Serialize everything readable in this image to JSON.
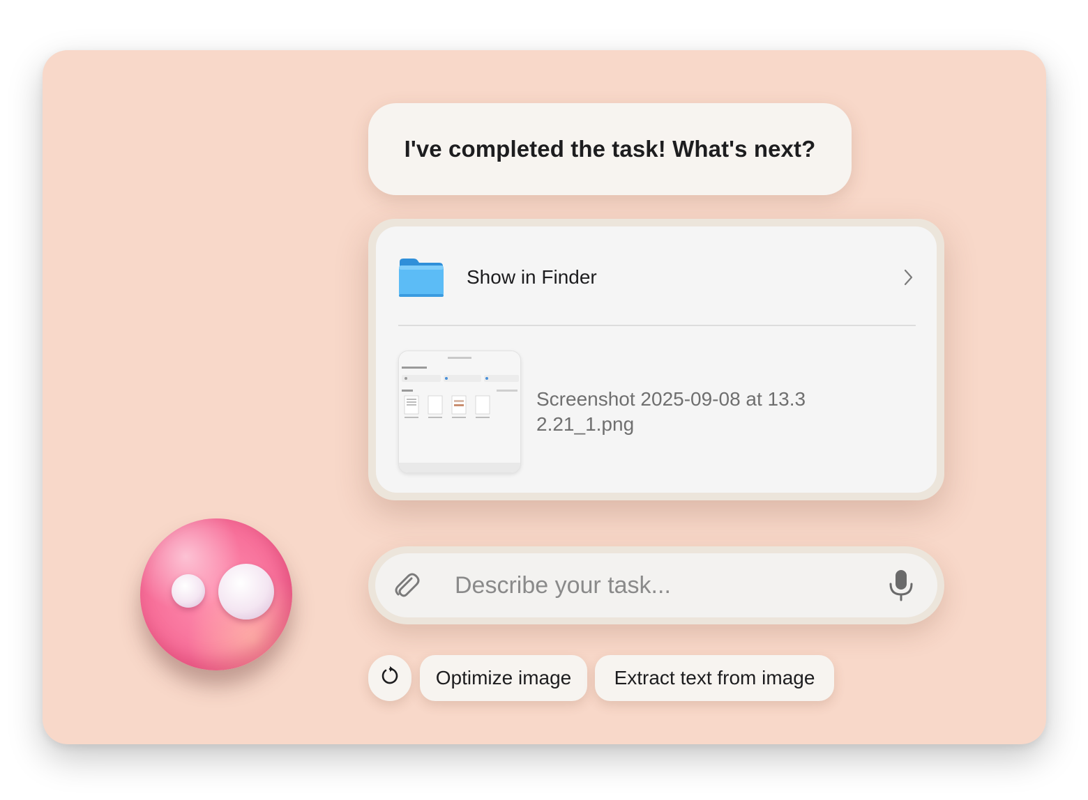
{
  "assistant": {
    "message": "I've completed the task! What's next?"
  },
  "result_card": {
    "show_in_finder_label": "Show in Finder",
    "file_name": "Screenshot 2025-09-08 at 13.32.21_1.png"
  },
  "composer": {
    "placeholder": "Describe your task...",
    "value": ""
  },
  "suggestions": {
    "refresh_icon": "refresh-icon",
    "items": [
      {
        "label": "Optimize image"
      },
      {
        "label": "Extract text from image"
      }
    ]
  },
  "colors": {
    "window_bg": "#f8d8c9",
    "card_bg": "#f5f5f5",
    "folder_blue": "#5cbcf6",
    "mascot_pink": "#f7709a"
  },
  "icons": {
    "folder": "folder-icon",
    "chevron": "chevron-right-icon",
    "attach": "paperclip-icon",
    "mic": "microphone-icon"
  }
}
